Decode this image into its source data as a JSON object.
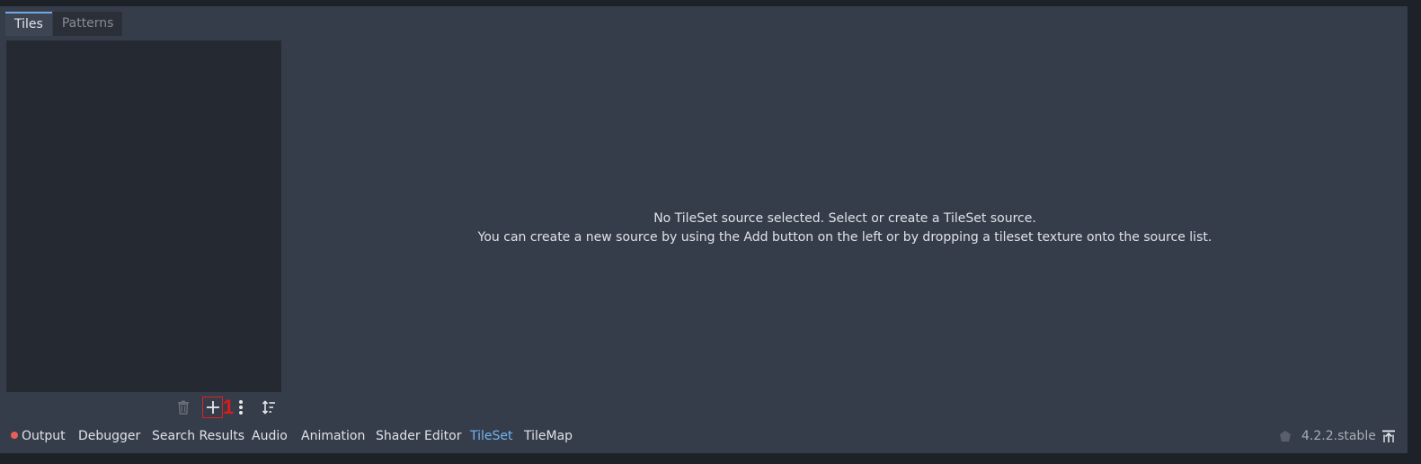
{
  "tabs": [
    {
      "label": "Tiles",
      "active": true
    },
    {
      "label": "Patterns",
      "active": false
    }
  ],
  "source_toolbar": {
    "delete_icon": "trash-icon",
    "add_icon": "plus-icon",
    "more_icon": "vertical-dots-icon",
    "sort_icon": "sort-icon",
    "annotation_label": "1"
  },
  "message": {
    "line1": "No TileSet source selected. Select or create a TileSet source.",
    "line2": "You can create a new source by using the Add button on the left or by dropping a tileset texture onto the source list."
  },
  "bottom_panel": {
    "tabs": [
      {
        "label": "Output",
        "has_status_dot": true
      },
      {
        "label": "Debugger"
      },
      {
        "label": "Search Results"
      },
      {
        "label": "Audio"
      },
      {
        "label": "Animation"
      },
      {
        "label": "Shader Editor"
      },
      {
        "label": "TileSet",
        "active": true
      },
      {
        "label": "TileMap"
      }
    ],
    "version": "4.2.2.stable",
    "version_icon": "engine-icon",
    "expand_icon": "expand-panel-icon"
  },
  "colors": {
    "accent": "#70b4f3",
    "status_dot": "#e6605a",
    "annotation": "#e01a1a"
  }
}
